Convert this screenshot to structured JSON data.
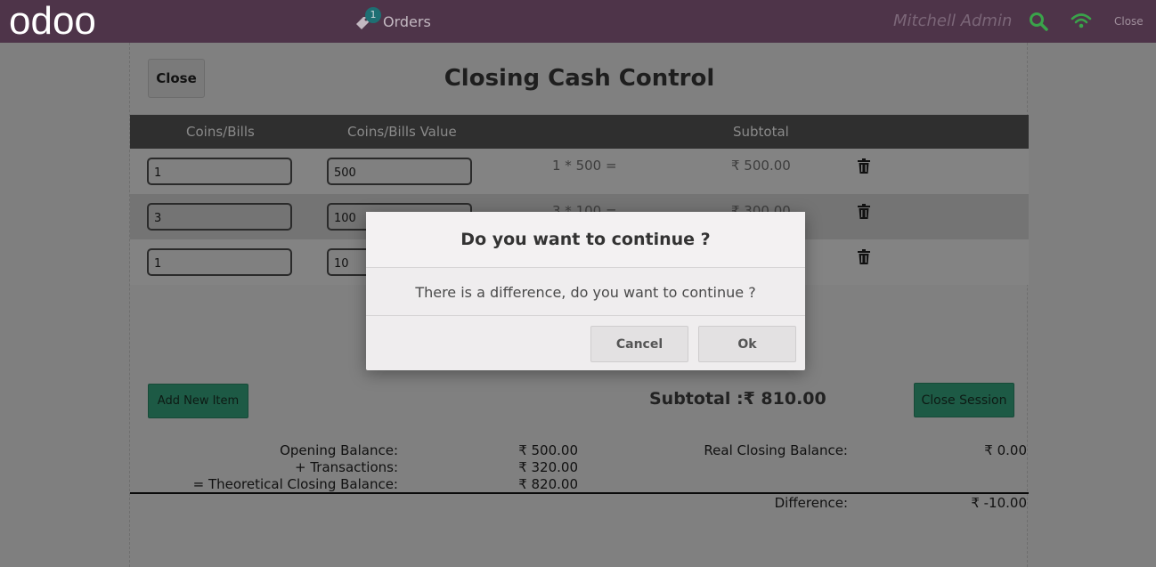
{
  "topbar": {
    "logo": "odoo",
    "orders_label": "Orders",
    "orders_count": "1",
    "username": "Mitchell Admin",
    "close_label": "Close",
    "icons": [
      "tag-icon",
      "search-icon",
      "wifi-icon"
    ]
  },
  "cash_control": {
    "close_label": "Close",
    "title": "Closing Cash Control",
    "headers": [
      "Coins/Bills",
      "Coins/Bills Value",
      "Subtotal"
    ],
    "rows": [
      {
        "coins": "1",
        "value": "500",
        "calc": "1 * 500 =",
        "subtotal": "₹ 500.00"
      },
      {
        "coins": "3",
        "value": "100",
        "calc": "3 * 100 =",
        "subtotal": "₹ 300.00"
      },
      {
        "coins": "1",
        "value": "10",
        "calc": "",
        "subtotal": ""
      }
    ],
    "add_label": "Add New Item",
    "subtotal_text": "Subtotal :₹ 810.00",
    "close_session_label": "Close Session"
  },
  "balances": {
    "opening_label": "Opening Balance:",
    "opening_value": "₹ 500.00",
    "transactions_label": "+ Transactions:",
    "transactions_value": "₹ 320.00",
    "theoretical_label": "= Theoretical Closing Balance:",
    "theoretical_value": "₹ 820.00",
    "real_label": "Real Closing Balance:",
    "real_value": "₹ 0.00",
    "difference_label": "Difference:",
    "difference_value": "₹ -10.00"
  },
  "modal": {
    "title": "Do you want to continue ?",
    "message": "There is a difference, do you want to continue ?",
    "cancel_label": "Cancel",
    "ok_label": "Ok"
  },
  "colors": {
    "topbar": "#4e3449",
    "accent_green": "#1d5a45",
    "icon_green": "#3aa34a"
  }
}
